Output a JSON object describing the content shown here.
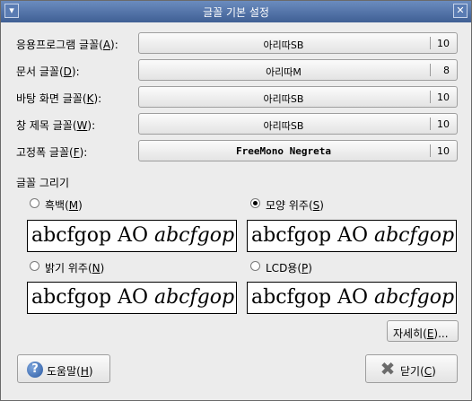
{
  "window": {
    "title": "글꼴 기본 설정",
    "menu_glyph": "▾",
    "close_glyph": "✕"
  },
  "fonts": [
    {
      "label": "응용프로그램 글꼴(",
      "mnemonic": "A",
      "label_end": "):",
      "font": "아리따SB",
      "size": "10"
    },
    {
      "label": "문서 글꼴(",
      "mnemonic": "D",
      "label_end": "):",
      "font": "아리따M",
      "size": "8"
    },
    {
      "label": "바탕 화면 글꼴(",
      "mnemonic": "K",
      "label_end": "):",
      "font": "아리따SB",
      "size": "10"
    },
    {
      "label": "창 제목 글꼴(",
      "mnemonic": "W",
      "label_end": "):",
      "font": "아리따SB",
      "size": "10"
    },
    {
      "label": "고정폭 글꼴(",
      "mnemonic": "F",
      "label_end": "):",
      "font": "FreeMono Negreta",
      "size": "10"
    }
  ],
  "rendering": {
    "section_title": "글꼴 그리기",
    "options": [
      {
        "label": "흑백(",
        "mnemonic": "M",
        "label_end": ")",
        "selected": false
      },
      {
        "label": "모양 위주(",
        "mnemonic": "S",
        "label_end": ")",
        "selected": true
      },
      {
        "label": "밝기 위주(",
        "mnemonic": "N",
        "label_end": ")",
        "selected": false
      },
      {
        "label": "LCD용(",
        "mnemonic": "P",
        "label_end": ")",
        "selected": false
      }
    ],
    "preview_text": "abcfgop AO ",
    "preview_italic": "abcfgop"
  },
  "details_button": {
    "label": "자세히(",
    "mnemonic": "E",
    "label_end": ")..."
  },
  "help_button": {
    "label": "도움말(",
    "mnemonic": "H",
    "label_end": ")",
    "icon_glyph": "?"
  },
  "close_button": {
    "label": "닫기(",
    "mnemonic": "C",
    "label_end": ")",
    "icon_glyph": "✖"
  }
}
